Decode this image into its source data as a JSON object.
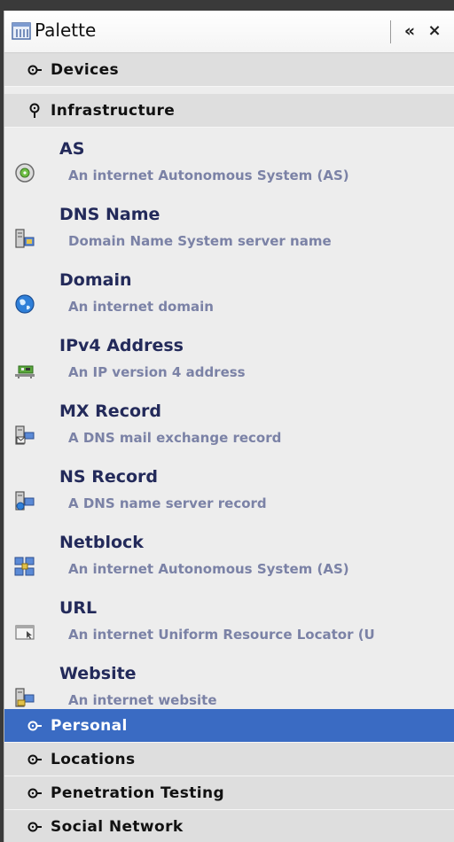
{
  "palette": {
    "title": "Palette",
    "minimize_label": "«",
    "close_label": "×"
  },
  "categories_top": [
    {
      "label": "Devices",
      "icon": "expand-icon",
      "state": "collapsed"
    },
    {
      "label": "Infrastructure",
      "icon": "expanded-pin-icon",
      "state": "expanded"
    }
  ],
  "entities": [
    {
      "title": "AS",
      "description": "An internet Autonomous System (AS)",
      "icon": "autonomous-system-icon"
    },
    {
      "title": "DNS Name",
      "description": "Domain Name System server name",
      "icon": "dns-server-icon"
    },
    {
      "title": "Domain",
      "description": "An internet domain",
      "icon": "globe-icon"
    },
    {
      "title": "IPv4 Address",
      "description": "An IP version 4 address",
      "icon": "network-card-icon"
    },
    {
      "title": "MX Record",
      "description": "A DNS mail exchange record",
      "icon": "mail-server-icon"
    },
    {
      "title": "NS Record",
      "description": "A DNS name server record",
      "icon": "name-server-icon"
    },
    {
      "title": "Netblock",
      "description": "An internet Autonomous System (AS)",
      "icon": "netblock-icon"
    },
    {
      "title": "URL",
      "description": "An internet Uniform Resource Locator (U",
      "icon": "url-window-icon"
    },
    {
      "title": "Website",
      "description": "An internet website",
      "icon": "website-server-icon"
    }
  ],
  "categories_bottom": [
    {
      "label": "Personal",
      "icon": "expand-icon",
      "selected": true
    },
    {
      "label": "Locations",
      "icon": "expand-icon",
      "selected": false
    },
    {
      "label": "Penetration Testing",
      "icon": "expand-icon",
      "selected": false
    },
    {
      "label": "Social Network",
      "icon": "expand-icon",
      "selected": false
    }
  ],
  "colors": {
    "selected_row": "#3a6bc3",
    "category_row": "#dedede",
    "panel_bg": "#ededed",
    "item_title": "#232a5a",
    "item_desc": "#7b82a6"
  }
}
